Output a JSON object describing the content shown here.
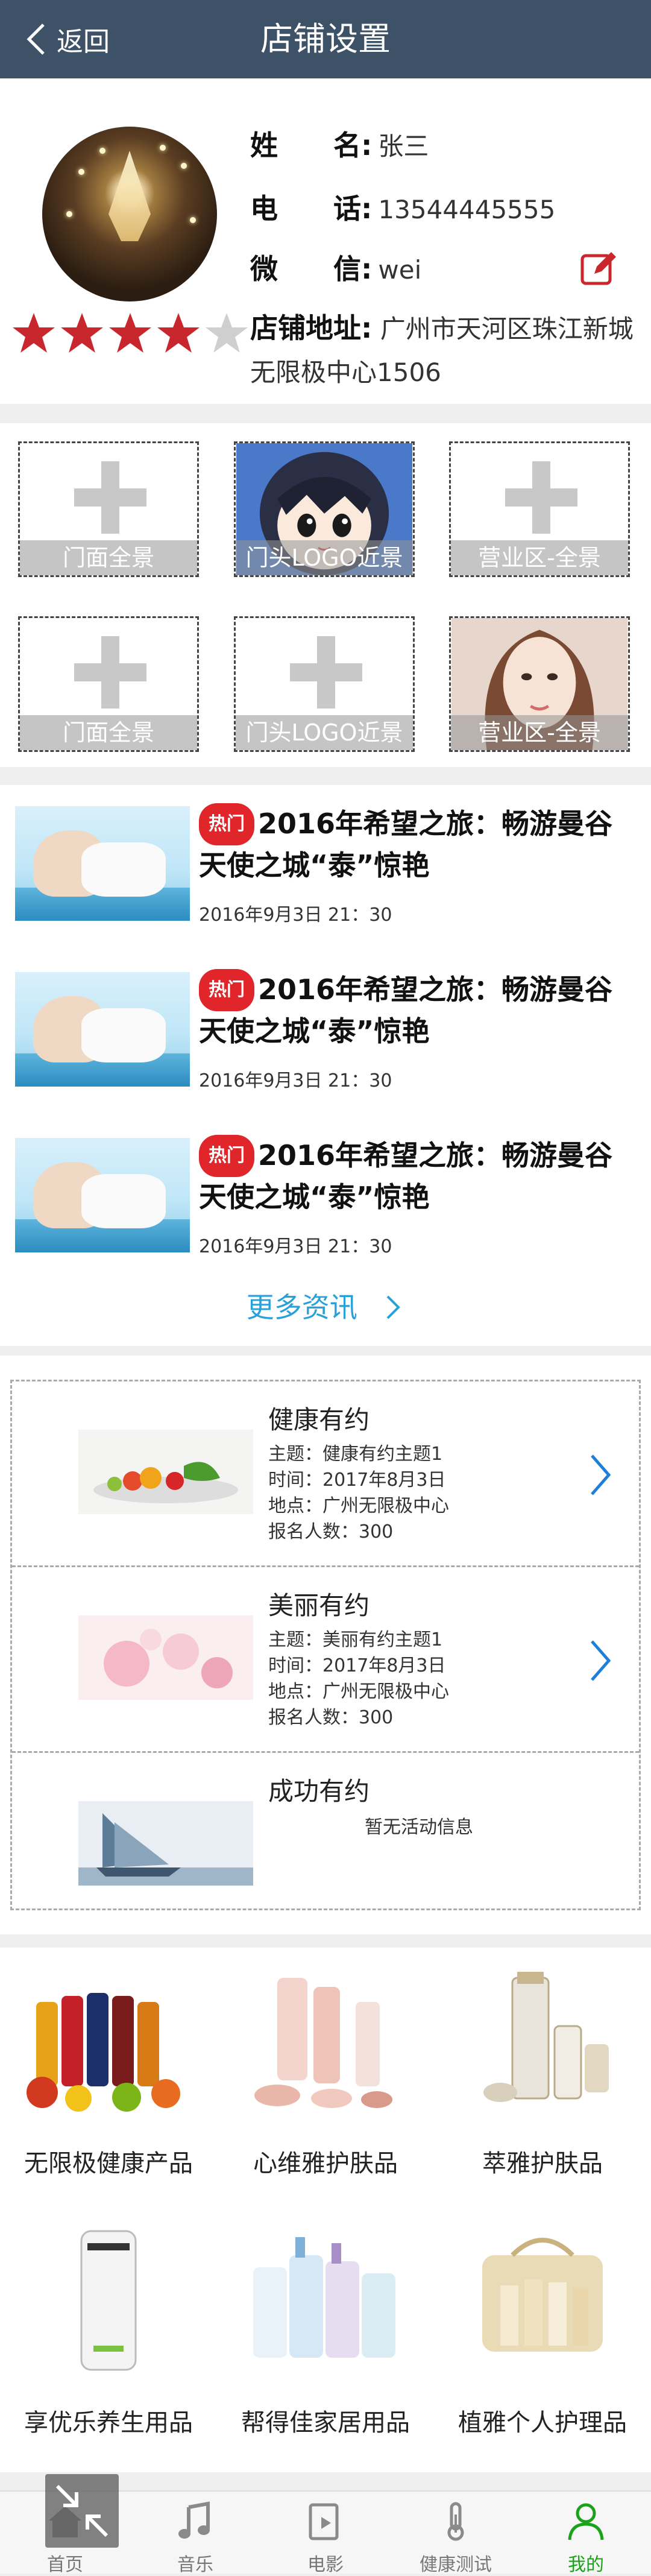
{
  "header": {
    "back_label": "返回",
    "title": "店铺设置"
  },
  "profile": {
    "name_label": "姓　　名:",
    "name_value": "张三",
    "phone_label": "电　　话:",
    "phone_value": "13544445555",
    "wechat_label": "微　　信:",
    "wechat_value": "wei",
    "address_label": "店铺地址:",
    "address_value": "广州市天河区珠江新城无限极中心1506",
    "rating": 4,
    "rating_max": 5
  },
  "photos": [
    {
      "caption": "门面全景",
      "filled": false
    },
    {
      "caption": "门头LOGO近景",
      "filled": true
    },
    {
      "caption": "营业区-全景",
      "filled": false
    },
    {
      "caption": "门面全景",
      "filled": false
    },
    {
      "caption": "门头LOGO近景",
      "filled": false
    },
    {
      "caption": "营业区-全景",
      "filled": true
    }
  ],
  "news": {
    "items": [
      {
        "badge": "热门",
        "title": "2016年希望之旅：畅游曼谷 天使之城“泰”惊艳",
        "date": "2016年9月3日 21：30"
      },
      {
        "badge": "热门",
        "title": "2016年希望之旅：畅游曼谷 天使之城“泰”惊艳",
        "date": "2016年9月3日 21：30"
      },
      {
        "badge": "热门",
        "title": "2016年希望之旅：畅游曼谷 天使之城“泰”惊艳",
        "date": "2016年9月3日 21：30"
      }
    ],
    "more_label": "更多资讯"
  },
  "events": [
    {
      "title": "健康有约",
      "topic": "主题：健康有约主题1",
      "time": "时间：2017年8月3日",
      "place": "地点：广州无限极中心",
      "count": "报名人数：300"
    },
    {
      "title": "美丽有约",
      "topic": "主题：美丽有约主题1",
      "time": "时间：2017年8月3日",
      "place": "地点：广州无限极中心",
      "count": "报名人数：300"
    },
    {
      "title": "成功有约",
      "empty": "暂无活动信息"
    }
  ],
  "products": [
    {
      "label": "无限极健康产品"
    },
    {
      "label": "心维雅护肤品"
    },
    {
      "label": "萃雅护肤品"
    },
    {
      "label": "享优乐养生用品"
    },
    {
      "label": "帮得佳家居用品"
    },
    {
      "label": "植雅个人护理品"
    }
  ],
  "nav": {
    "tabs": [
      {
        "label": "首页",
        "icon": "home-icon"
      },
      {
        "label": "音乐",
        "icon": "music-icon"
      },
      {
        "label": "电影",
        "icon": "movie-icon"
      },
      {
        "label": "健康测试",
        "icon": "thermometer-icon"
      },
      {
        "label": "我的",
        "icon": "user-icon",
        "active": true
      }
    ]
  },
  "colors": {
    "header": "#3d5266",
    "hot_badge": "#e0262b",
    "link": "#2aa0d8",
    "active_tab": "#1aa31a",
    "star": "#c8282d"
  }
}
